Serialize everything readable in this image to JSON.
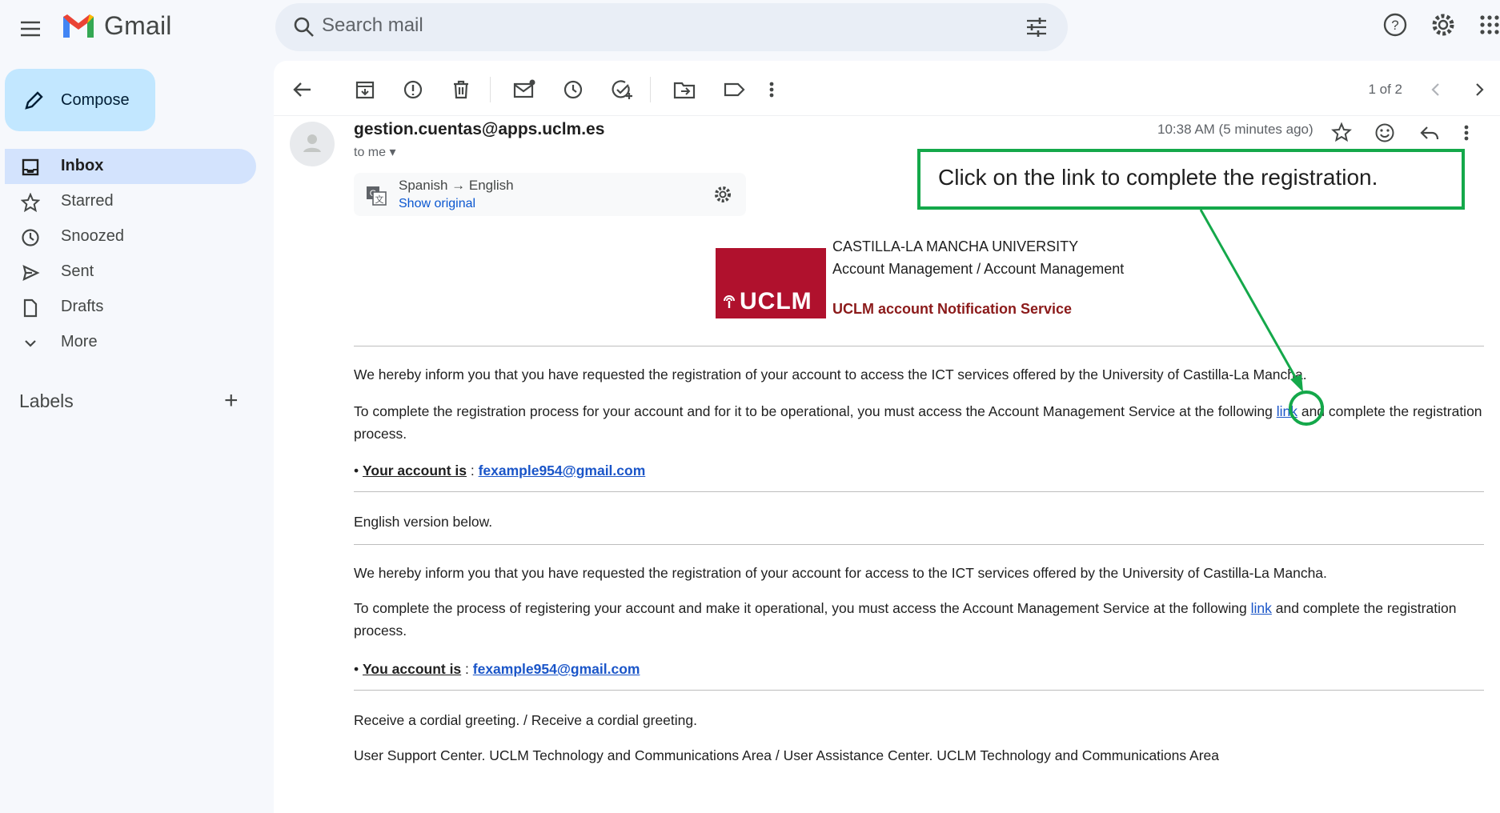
{
  "app": {
    "name": "Gmail"
  },
  "search": {
    "placeholder": "Search mail"
  },
  "sidebar": {
    "compose": "Compose",
    "items": [
      {
        "label": "Inbox",
        "icon": "inbox-icon",
        "active": true
      },
      {
        "label": "Starred",
        "icon": "star-icon"
      },
      {
        "label": "Snoozed",
        "icon": "clock-icon"
      },
      {
        "label": "Sent",
        "icon": "send-icon"
      },
      {
        "label": "Drafts",
        "icon": "draft-icon"
      },
      {
        "label": "More",
        "icon": "chevron-down-icon"
      }
    ],
    "labels_heading": "Labels",
    "labels_add": "+"
  },
  "toolbar": {
    "pager": "1 of 2"
  },
  "message": {
    "sender": "gestion.cuentas@apps.uclm.es",
    "to": "to me",
    "time": "10:38 AM (5 minutes ago)",
    "translation": {
      "text": "Spanish → English",
      "show_original": "Show original"
    }
  },
  "body": {
    "logo_text": "UCLM",
    "org_line1": "CASTILLA-LA MANCHA UNIVERSITY",
    "org_line2": "Account Management / Account Management",
    "org_line3": "UCLM account Notification Service",
    "p1": "We hereby inform you that you have requested the registration of your account to access the ICT services offered by the University of Castilla-La Mancha.",
    "p2_a": "To complete the registration process for your account and for it to be operational, you must access the Account Management Service at the following ",
    "p2_link": "link",
    "p2_b": " and complete the registration process.",
    "account1_label": "Your account is",
    "account1_email": "fexample954@gmail.com",
    "english_below": "English version below.",
    "p3": "We hereby inform you that you have requested the registration of your account for access to the ICT services offered by the University of Castilla-La Mancha.",
    "p4_a": "To complete the process of registering your account and make it operational, you must access the Account Management Service at the following ",
    "p4_link": "link",
    "p4_b": " and complete the registration process.",
    "account2_label": "You account is",
    "account2_email": "fexample954@gmail.com",
    "greeting": "Receive a cordial greeting. / Receive a cordial greeting.",
    "signature": "User Support Center. UCLM Technology and Communications Area / User Assistance Center. UCLM Technology and Communications Area"
  },
  "annotation": {
    "text": "Click on the link to complete the registration."
  },
  "colors": {
    "accent": "#14a84a",
    "uclm_red": "#b0112d",
    "link": "#1a55c8"
  }
}
